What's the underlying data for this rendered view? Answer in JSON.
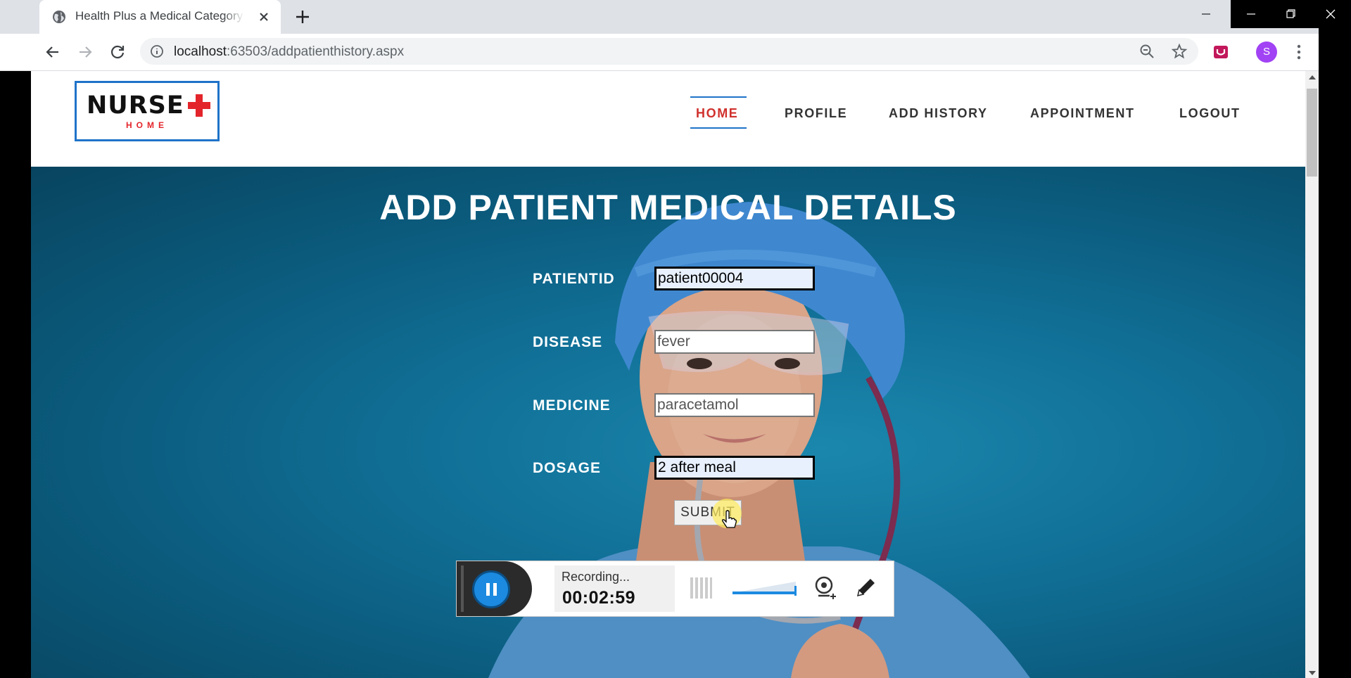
{
  "browser": {
    "tab_title": "Health Plus a Medical Category Bootstrap",
    "url_host": "localhost",
    "url_path": ":63503/addpatienthistory.aspx",
    "profile_initial": "S"
  },
  "site": {
    "logo_word": "NURSE",
    "logo_sub": "HOME",
    "nav": [
      {
        "label": "HOME",
        "active": true
      },
      {
        "label": "PROFILE",
        "active": false
      },
      {
        "label": "ADD HISTORY",
        "active": false
      },
      {
        "label": "APPOINTMENT",
        "active": false
      },
      {
        "label": "LOGOUT",
        "active": false
      }
    ],
    "accent_color": "#1f73c9",
    "brand_red": "#e3252b"
  },
  "form": {
    "heading": "ADD PATIENT MEDICAL DETAILS",
    "fields": [
      {
        "label": "PATIENTID",
        "value": "patient00004"
      },
      {
        "label": "DISEASE",
        "value": "fever"
      },
      {
        "label": "MEDICINE",
        "value": "paracetamol"
      },
      {
        "label": "DOSAGE",
        "value": "2 after meal"
      }
    ],
    "submit_label": "SUBMIT"
  },
  "recorder": {
    "status": "Recording...",
    "elapsed": "00:02:59"
  },
  "icons": [
    "globe-icon",
    "close-icon",
    "plus-icon",
    "back-icon",
    "forward-icon",
    "reload-icon",
    "info-icon",
    "zoom-icon",
    "star-icon",
    "extension-icon",
    "menu-icon",
    "pause-icon",
    "webcam-icon",
    "pen-icon"
  ]
}
